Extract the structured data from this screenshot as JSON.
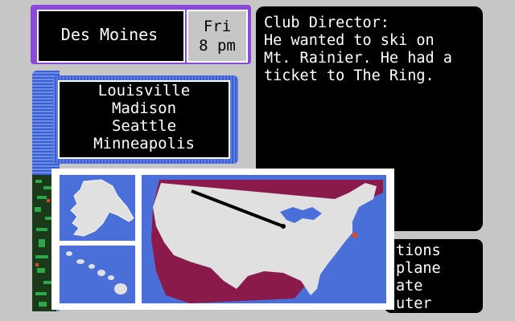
{
  "location": {
    "city": "Des Moines"
  },
  "time": {
    "day": "Fri",
    "hour": "8 pm"
  },
  "dialog": {
    "speaker": "Club Director:",
    "text": "He wanted to ski on\nMt. Rainier. He had a\nticket to The Ring."
  },
  "destinations": [
    "Louisville",
    "Madison",
    "Seattle",
    "Minneapolis"
  ],
  "options_partial": [
    "tions",
    "plane",
    "ate",
    "uter"
  ],
  "colors": {
    "purple_frame": "#8a4ad8",
    "blue_panel": "#4a6fd8",
    "map_land": "#e0e0e0",
    "map_shadow": "#8a1a4a",
    "map_water": "#4a6fd8",
    "panel_gray": "#c6c6c6"
  },
  "icons": {
    "route_line": "flight-path-line",
    "side_decor": "decorative-strip"
  }
}
